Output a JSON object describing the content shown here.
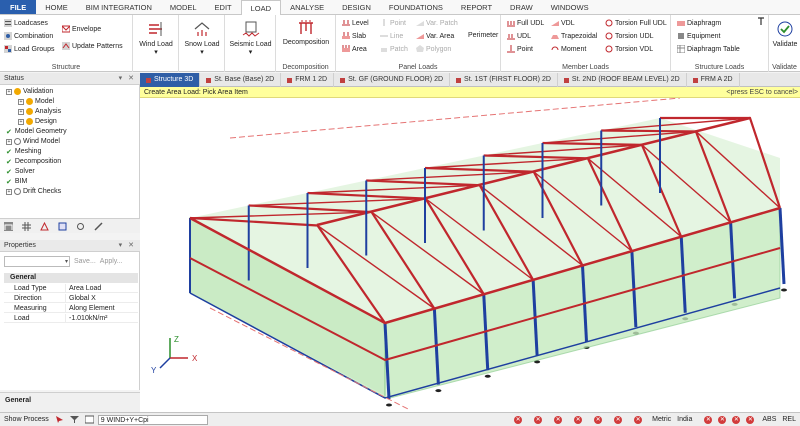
{
  "menu": {
    "tabs": [
      "FILE",
      "HOME",
      "BIM INTEGRATION",
      "MODEL",
      "EDIT",
      "LOAD",
      "ANALYSE",
      "DESIGN",
      "FOUNDATIONS",
      "REPORT",
      "DRAW",
      "WINDOWS"
    ],
    "active": "LOAD"
  },
  "ribbon": {
    "structure": {
      "label": "Structure",
      "loadcases": "Loadcases",
      "combination": "Combination",
      "load_groups": "Load Groups",
      "envelope": "Envelope",
      "update_patterns": "Update Patterns"
    },
    "wind_load": "Wind Load",
    "snow_load": "Snow Load",
    "seismic_load": "Seismic Load",
    "decomposition": {
      "label": "Decomposition",
      "button": "Decomposition"
    },
    "panel_loads": {
      "label": "Panel Loads",
      "level": "Level",
      "slab": "Slab",
      "area": "Area",
      "point": "Point",
      "line": "Line",
      "patch": "Patch",
      "var_patch": "Var. Patch",
      "var_area": "Var. Area",
      "polygon": "Polygon",
      "perimeter": "Perimeter"
    },
    "member_loads": {
      "label": "Member Loads",
      "full_udl": "Full UDL",
      "udl": "UDL",
      "point": "Point",
      "vdl": "VDL",
      "trapezoidal": "Trapezoidal",
      "moment": "Moment",
      "torsion_full_udl": "Torsion Full UDL",
      "torsion_udl": "Torsion UDL",
      "torsion_vdl": "Torsion VDL"
    },
    "structure_loads": {
      "label": "Structure Loads",
      "diaphragm": "Diaphragm",
      "equipment": "Equipment",
      "diaphragm_table": "Diaphragm Table"
    },
    "validate": {
      "label": "Validate",
      "button": "Validate"
    }
  },
  "status_panel": {
    "title": "Status",
    "controls": "▾ ✕",
    "items": [
      {
        "label": "Validation",
        "level": 0,
        "icon": "warning"
      },
      {
        "label": "Model",
        "level": 1,
        "icon": "warning"
      },
      {
        "label": "Analysis",
        "level": 1,
        "icon": "warning"
      },
      {
        "label": "Design",
        "level": 1,
        "icon": "warning"
      },
      {
        "label": "Model Geometry",
        "level": 0,
        "icon": "check"
      },
      {
        "label": "Wind Model",
        "level": 0,
        "icon": "info"
      },
      {
        "label": "Meshing",
        "level": 0,
        "icon": "check"
      },
      {
        "label": "Decomposition",
        "level": 0,
        "icon": "check"
      },
      {
        "label": "Solver",
        "level": 0,
        "icon": "check"
      },
      {
        "label": "BIM",
        "level": 0,
        "icon": "check"
      },
      {
        "label": "Drift Checks",
        "level": 0,
        "icon": "info"
      }
    ]
  },
  "properties_panel": {
    "title": "Properties",
    "controls": "▾ ✕",
    "save": "Save...",
    "apply": "Apply...",
    "group": "General",
    "rows": [
      {
        "key": "Load Type",
        "value": "Area Load"
      },
      {
        "key": "Direction",
        "value": "Global X"
      },
      {
        "key": "Measuring",
        "value": "Along Element"
      },
      {
        "key": "Load",
        "value": "-1.010kN/m²"
      }
    ],
    "footer": "General"
  },
  "doc_tabs": [
    "Structure 3D",
    "St. Base (Base) 2D",
    "FRM 1 2D",
    "St. GF (GROUND FLOOR) 2D",
    "St. 1ST (FIRST FLOOR) 2D",
    "St. 2ND (ROOF BEAM LEVEL) 2D",
    "FRM A 2D"
  ],
  "hint": {
    "text": "Create Area Load: Pick Area Item",
    "right": "<press ESC to cancel>"
  },
  "axis": {
    "x": "X",
    "y": "Y",
    "z": "Z"
  },
  "statusbar": {
    "show_process": "Show Process",
    "loadcase": "9 WIND+Y+Cpi",
    "units": "Metric",
    "region": "India",
    "abs": "ABS",
    "rel": "REL"
  },
  "colors": {
    "accent": "#2f5ea6",
    "column": "#1e3fa0",
    "beam": "#c0272d",
    "panel": "#b9e6b2",
    "hint_bg": "#ffff9c"
  }
}
